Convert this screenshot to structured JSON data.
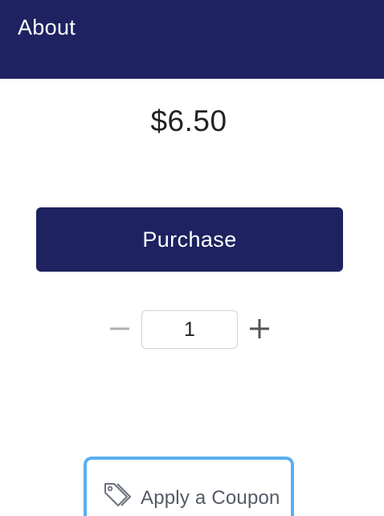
{
  "header": {
    "title": "About"
  },
  "product": {
    "price": "$6.50"
  },
  "purchase": {
    "label": "Purchase"
  },
  "quantity": {
    "value": "1",
    "decrement_icon": "minus-icon",
    "increment_icon": "plus-icon"
  },
  "coupon": {
    "label": "Apply a Coupon",
    "icon": "tags-icon"
  },
  "colors": {
    "brand": "#1e2260",
    "focus_ring": "#5aaff0",
    "disabled_minus": "#b0b0b0",
    "plus": "#555555"
  }
}
